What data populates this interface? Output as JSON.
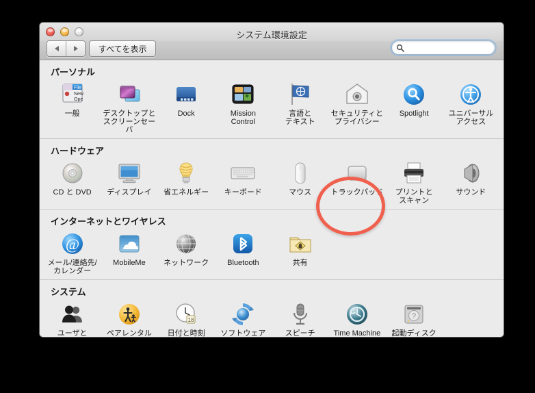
{
  "window": {
    "title": "システム環境設定",
    "traffic_lights": [
      "close",
      "minimize",
      "zoom-disabled"
    ],
    "back_label": "◀",
    "forward_label": "▶",
    "show_all_label": "すべてを表示",
    "search": {
      "value": "",
      "placeholder": ""
    }
  },
  "annotation": {
    "type": "ellipse-highlight",
    "color": "#f0604e",
    "target": "トラックパッド"
  },
  "sections": [
    {
      "title": "パーソナル",
      "items": [
        {
          "label": "一般",
          "icon": "general-icon"
        },
        {
          "label": "デスクトップと\nスクリーンセーバ",
          "icon": "desktop-screensaver-icon"
        },
        {
          "label": "Dock",
          "icon": "dock-icon"
        },
        {
          "label": "Mission\nControl",
          "icon": "mission-control-icon"
        },
        {
          "label": "言語と\nテキスト",
          "icon": "language-text-icon"
        },
        {
          "label": "セキュリティと\nプライバシー",
          "icon": "security-privacy-icon"
        },
        {
          "label": "Spotlight",
          "icon": "spotlight-icon"
        },
        {
          "label": "ユニバーサル\nアクセス",
          "icon": "universal-access-icon"
        }
      ]
    },
    {
      "title": "ハードウェア",
      "items": [
        {
          "label": "CD と DVD",
          "icon": "cd-dvd-icon"
        },
        {
          "label": "ディスプレイ",
          "icon": "displays-icon"
        },
        {
          "label": "省エネルギー",
          "icon": "energy-saver-icon"
        },
        {
          "label": "キーボード",
          "icon": "keyboard-icon"
        },
        {
          "label": "マウス",
          "icon": "mouse-icon"
        },
        {
          "label": "トラックパッド",
          "icon": "trackpad-icon"
        },
        {
          "label": "プリントと\nスキャン",
          "icon": "print-scan-icon"
        },
        {
          "label": "サウンド",
          "icon": "sound-icon"
        }
      ]
    },
    {
      "title": "インターネットとワイヤレス",
      "items": [
        {
          "label": "メール/連絡先/\nカレンダー",
          "icon": "mail-contacts-calendars-icon"
        },
        {
          "label": "MobileMe",
          "icon": "mobileme-icon"
        },
        {
          "label": "ネットワーク",
          "icon": "network-icon"
        },
        {
          "label": "Bluetooth",
          "icon": "bluetooth-icon"
        },
        {
          "label": "共有",
          "icon": "sharing-icon"
        }
      ]
    },
    {
      "title": "システム",
      "items": [
        {
          "label": "ユーザと\nグループ",
          "icon": "users-groups-icon"
        },
        {
          "label": "ペアレンタル\nコントロール",
          "icon": "parental-controls-icon"
        },
        {
          "label": "日付と時刻",
          "icon": "date-time-icon"
        },
        {
          "label": "ソフトウェア\nアップデート",
          "icon": "software-update-icon"
        },
        {
          "label": "スピーチ",
          "icon": "speech-icon"
        },
        {
          "label": "Time Machine",
          "icon": "time-machine-icon"
        },
        {
          "label": "起動ディスク",
          "icon": "startup-disk-icon"
        }
      ]
    }
  ]
}
